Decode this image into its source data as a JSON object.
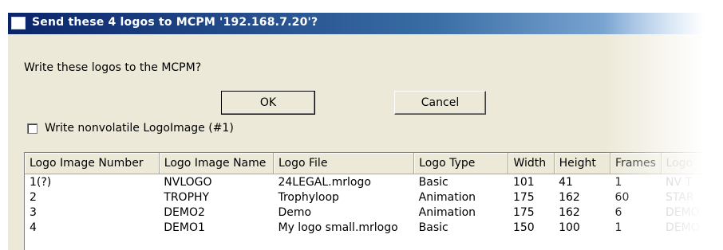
{
  "window": {
    "title": "Send these 4 logos to MCPM '192.168.7.20'?"
  },
  "prompt": "Write these logos to the MCPM?",
  "buttons": {
    "ok_label": "OK",
    "cancel_label": "Cancel"
  },
  "checkbox": {
    "label": "Write nonvolatile LogoImage (#1)",
    "checked": false
  },
  "table": {
    "columns": [
      "Logo Image Number",
      "Logo Image Name",
      "Logo File",
      "Logo Type",
      "Width",
      "Height",
      "Frames",
      "Logo"
    ],
    "rows": [
      [
        "1(?)",
        "NVLOGO",
        "24LEGAL.mrlogo",
        "Basic",
        "101",
        "41",
        "1",
        "NV T"
      ],
      [
        "2",
        "TROPHY",
        "Trophyloop",
        "Animation",
        "175",
        "162",
        "60",
        "STAR"
      ],
      [
        "3",
        "DEMO2",
        "Demo",
        "Animation",
        "175",
        "162",
        "6",
        "DEMO"
      ],
      [
        "4",
        "DEMO1",
        "My logo small.mrlogo",
        "Basic",
        "150",
        "100",
        "1",
        "DEMO"
      ]
    ]
  },
  "colors": {
    "titlebar_start": "#0a246a",
    "titlebar_end": "#a6caf0",
    "dialog_face": "#ece9d8"
  }
}
